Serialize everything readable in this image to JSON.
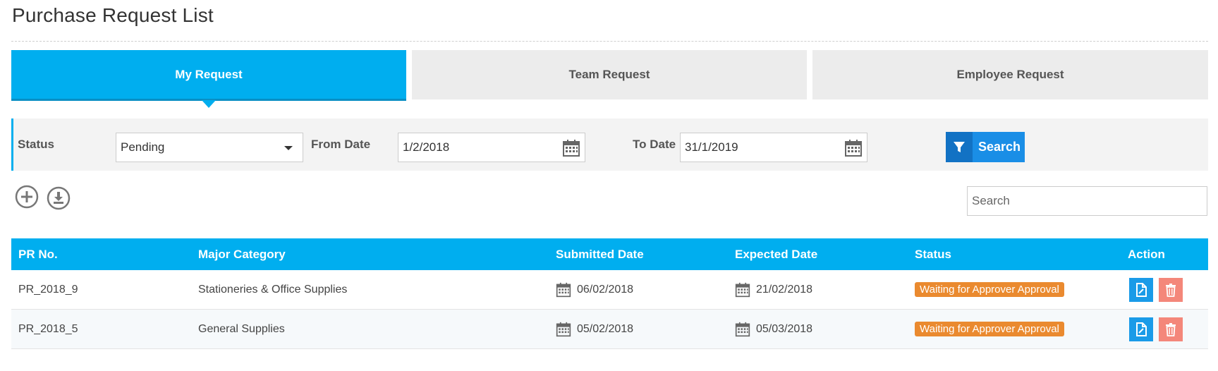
{
  "page": {
    "title": "Purchase Request List"
  },
  "tabs": [
    {
      "label": "My Request",
      "active": true
    },
    {
      "label": "Team Request",
      "active": false
    },
    {
      "label": "Employee Request",
      "active": false
    }
  ],
  "filters": {
    "status_label": "Status",
    "status_value": "Pending",
    "from_label": "From Date",
    "from_value": "1/2/2018",
    "to_label": "To Date",
    "to_value": "31/1/2019",
    "search_button": "Search"
  },
  "toolbar": {
    "search_placeholder": "Search",
    "add_icon": "plus-circle-icon",
    "download_icon": "download-icon"
  },
  "table": {
    "headers": [
      "PR No.",
      "Major Category",
      "Submitted Date",
      "Expected Date",
      "Status",
      "Action"
    ],
    "rows": [
      {
        "pr_no": "PR_2018_9",
        "category": "Stationeries & Office Supplies",
        "submitted": "06/02/2018",
        "expected": "21/02/2018",
        "status": "Waiting for Approver Approval"
      },
      {
        "pr_no": "PR_2018_5",
        "category": "General Supplies",
        "submitted": "05/02/2018",
        "expected": "05/03/2018",
        "status": "Waiting for Approver Approval"
      }
    ]
  },
  "colors": {
    "accent": "#00aeef",
    "button": "#1a8ee6",
    "badge": "#ea8a2f",
    "delete": "#f4877a"
  }
}
